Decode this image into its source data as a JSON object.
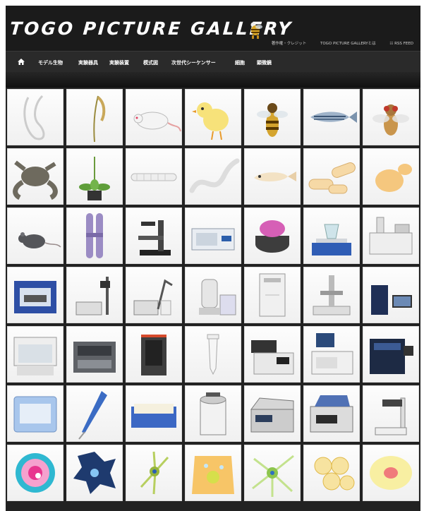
{
  "header": {
    "title": "TOGO PICTURE GALLERY",
    "links": [
      "著作権・クレジット",
      "TOGO PICTURE GALLERYとは",
      "RSS FEED"
    ]
  },
  "nav": {
    "items": [
      "モデル生物",
      "実験器具",
      "実験装置",
      "模式図",
      "次世代シーケンサー",
      "細胞",
      "顕微鏡"
    ]
  },
  "gallery": {
    "rows": [
      [
        {
          "icon": "model-organism-outline-icon"
        },
        {
          "icon": "rice-plant-icon"
        },
        {
          "icon": "rat-icon"
        },
        {
          "icon": "chick-icon"
        },
        {
          "icon": "honeybee-icon"
        },
        {
          "icon": "zebrafish-icon"
        },
        {
          "icon": "fruit-fly-icon"
        }
      ],
      [
        {
          "icon": "frog-icon"
        },
        {
          "icon": "arabidopsis-icon"
        },
        {
          "icon": "larva-icon"
        },
        {
          "icon": "nematode-icon"
        },
        {
          "icon": "medaka-fish-icon"
        },
        {
          "icon": "bacteria-rod-icon"
        },
        {
          "icon": "yeast-icon"
        }
      ],
      [
        {
          "icon": "mouse-icon"
        },
        {
          "icon": "chromosome-icon"
        },
        {
          "icon": "inverted-microscope-icon"
        },
        {
          "icon": "incubator-icon"
        },
        {
          "icon": "centrifuge-icon"
        },
        {
          "icon": "stirrer-hotplate-icon"
        },
        {
          "icon": "hplc-system-icon"
        }
      ],
      [
        {
          "icon": "blue-instrument-icon"
        },
        {
          "icon": "homogenizer-icon"
        },
        {
          "icon": "ph-meter-icon"
        },
        {
          "icon": "fermenter-icon"
        },
        {
          "icon": "freezer-icon"
        },
        {
          "icon": "microscope-stage-icon"
        },
        {
          "icon": "sequencer-computer-icon"
        }
      ],
      [
        {
          "icon": "clean-bench-icon"
        },
        {
          "icon": "pcr-instrument-icon"
        },
        {
          "icon": "dark-sequencer-icon"
        },
        {
          "icon": "micro-tube-icon"
        },
        {
          "icon": "analyzer-icon"
        },
        {
          "icon": "monitor-instrument-icon"
        },
        {
          "icon": "next-gen-sequencer-icon"
        }
      ],
      [
        {
          "icon": "sample-station-icon"
        },
        {
          "icon": "pipette-icon"
        },
        {
          "icon": "well-plate-icon"
        },
        {
          "icon": "autoclave-icon"
        },
        {
          "icon": "thermal-cycler-icon"
        },
        {
          "icon": "printer-cycler-icon"
        },
        {
          "icon": "stereo-microscope-icon"
        }
      ],
      [
        {
          "icon": "cell-round-icon"
        },
        {
          "icon": "cell-irregular-icon"
        },
        {
          "icon": "nerve-cell-icon"
        },
        {
          "icon": "epithelial-cell-icon"
        },
        {
          "icon": "neuron-icon"
        },
        {
          "icon": "cell-cluster-icon"
        },
        {
          "icon": "cell-oval-icon"
        }
      ]
    ]
  }
}
